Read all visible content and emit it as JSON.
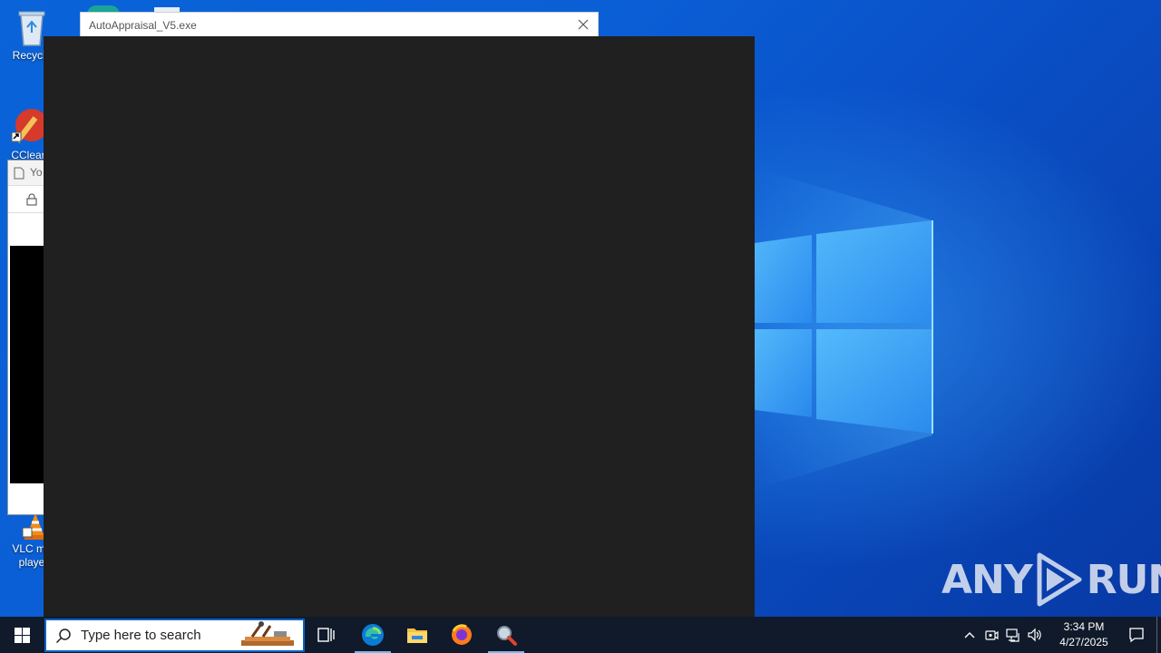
{
  "desktop": {
    "icons": [
      {
        "label": "Recycle"
      },
      {
        "label": "CClear"
      },
      {
        "label": "VLC me",
        "label2": "playe"
      }
    ],
    "watermark": {
      "left": "ANY",
      "right": "RUN"
    },
    "background_window": {
      "tab_text": "Yo"
    }
  },
  "app_window": {
    "title": "AutoAppraisal_V5.exe"
  },
  "taskbar": {
    "search_placeholder": "Type here to search",
    "pinned": [
      "Task View",
      "Microsoft Edge",
      "File Explorer",
      "Firefox",
      "Search tool"
    ],
    "clock": {
      "time": "3:34 PM",
      "date": "4/27/2025"
    }
  },
  "colors": {
    "console_bg": "#202020",
    "taskbar_bg": "#101a2a",
    "search_border": "#0b63c9",
    "wallpaper_blue": "#0a5fd6"
  }
}
